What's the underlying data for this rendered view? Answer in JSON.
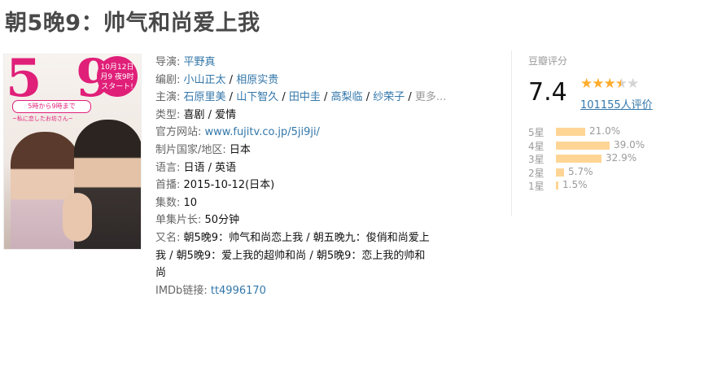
{
  "title": "朝5晚9：帅气和尚爱上我",
  "poster": {
    "num5": "5",
    "num9": "9",
    "badge_line1": "10月12日",
    "badge_line2": "月9 夜9时",
    "badge_line3": "スタート!",
    "band": "5時から9時まで",
    "subtitle": "~私に恋したお坊さん~"
  },
  "info": {
    "director_label": "导演",
    "director": "平野真",
    "writer_label": "编剧",
    "writers": [
      "小山正太",
      "相原实贵"
    ],
    "cast_label": "主演",
    "cast": [
      "石原里美",
      "山下智久",
      "田中圭",
      "高梨临",
      "纱荣子"
    ],
    "cast_more": "更多...",
    "genre_label": "类型:",
    "genre": "喜剧 / 爱情",
    "website_label": "官方网站:",
    "website": "www.fujitv.co.jp/5ji9ji/",
    "country_label": "制片国家/地区:",
    "country": "日本",
    "language_label": "语言:",
    "language": "日语 / 英语",
    "premiere_label": "首播:",
    "premiere": "2015-10-12(日本)",
    "episodes_label": "集数:",
    "episodes": "10",
    "runtime_label": "单集片长:",
    "runtime": "50分钟",
    "aka_label": "又名:",
    "aka_line1": "朝5晚9：帅气和尚恋上我 / 朝五晚九：俊俏和尚爱上",
    "aka_line2": "我 / 朝5晚9：爱上我的超帅和尚 / 朝5晚9：恋上我的帅和",
    "aka_line3": "尚",
    "imdb_label": "IMDb链接:",
    "imdb": "tt4996170"
  },
  "rating": {
    "label": "豆瓣评分",
    "score": "7.4",
    "stars_value": 3.5,
    "count": "101155人评价",
    "colors": {
      "star": "#ffac2d",
      "bar": "#ffd596",
      "link": "#3377aa"
    },
    "breakdown": [
      {
        "level": "5星",
        "percent_text": "21.0%",
        "percent": 21.0
      },
      {
        "level": "4星",
        "percent_text": "39.0%",
        "percent": 39.0
      },
      {
        "level": "3星",
        "percent_text": "32.9%",
        "percent": 32.9
      },
      {
        "level": "2星",
        "percent_text": "5.7%",
        "percent": 5.7
      },
      {
        "level": "1星",
        "percent_text": "1.5%",
        "percent": 1.5
      }
    ]
  }
}
